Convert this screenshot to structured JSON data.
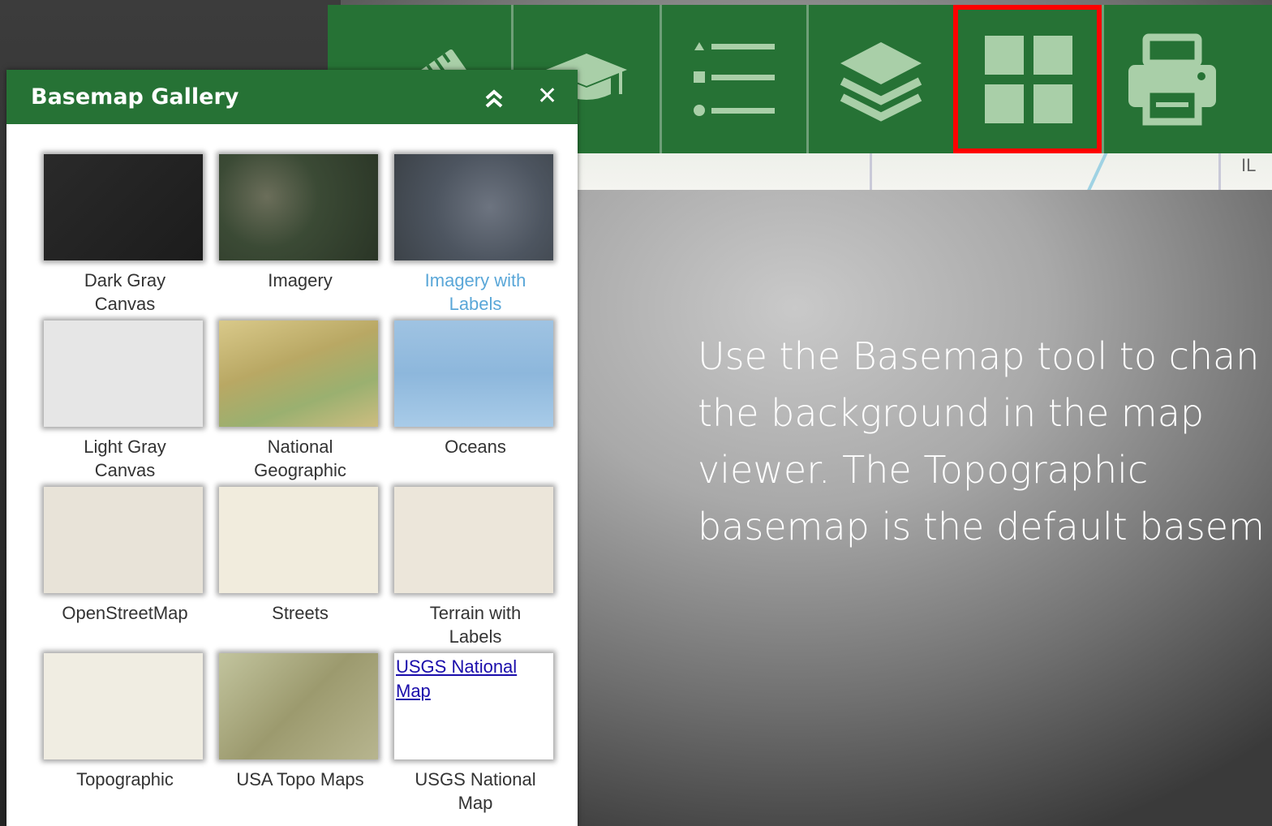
{
  "toolbar": {
    "buttons": [
      {
        "name": "measure",
        "icon": "ruler-icon"
      },
      {
        "name": "about",
        "icon": "graduation-cap-icon"
      },
      {
        "name": "legend",
        "icon": "list-icon"
      },
      {
        "name": "layers",
        "icon": "layers-icon"
      },
      {
        "name": "basemap-gallery",
        "icon": "grid-icon",
        "selected": true
      },
      {
        "name": "print",
        "icon": "printer-icon"
      }
    ],
    "map_label": "IL"
  },
  "panel": {
    "title": "Basemap Gallery",
    "collapse_icon": "double-chevron-up-icon",
    "close_icon": "close-icon",
    "close_glyph": "✕"
  },
  "basemaps": [
    {
      "label_line1": "Dark Gray",
      "label_line2": "Canvas",
      "thumb": "t-darkgray"
    },
    {
      "label_line1": "Imagery",
      "label_line2": "",
      "thumb": "t-imagery"
    },
    {
      "label_line1": "Imagery with",
      "label_line2": "Labels",
      "thumb": "t-imglab",
      "hover": true
    },
    {
      "label_line1": "Light Gray",
      "label_line2": "Canvas",
      "thumb": "t-lightgray"
    },
    {
      "label_line1": "National",
      "label_line2": "Geographic",
      "thumb": "t-natgeo"
    },
    {
      "label_line1": "Oceans",
      "label_line2": "",
      "thumb": "t-oceans"
    },
    {
      "label_line1": "OpenStreetMap",
      "label_line2": "",
      "thumb": "t-osm"
    },
    {
      "label_line1": "Streets",
      "label_line2": "",
      "thumb": "t-streets"
    },
    {
      "label_line1": "Terrain with",
      "label_line2": "Labels",
      "thumb": "t-terrain"
    },
    {
      "label_line1": "Topographic",
      "label_line2": "",
      "thumb": "t-topo"
    },
    {
      "label_line1": "USA Topo Maps",
      "label_line2": "",
      "thumb": "t-usatopo"
    },
    {
      "label_line1": "USGS National",
      "label_line2": "Map",
      "thumb": "t-usgs",
      "thumb_link_line1": "USGS National",
      "thumb_link_line2": "Map"
    }
  ],
  "caption": {
    "line1": "Use the Basemap tool to chan",
    "line2": "the background in the map",
    "line3": "viewer. The Topographic",
    "line4": "basemap is the default basem"
  },
  "colors": {
    "toolbar_green": "#267235",
    "icon_green": "#a9cfa8",
    "selected_outline": "#ff0000"
  }
}
